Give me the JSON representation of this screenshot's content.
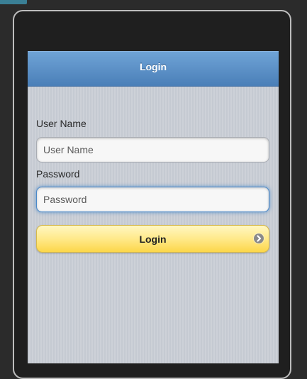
{
  "header": {
    "title": "Login"
  },
  "form": {
    "username": {
      "label": "User Name",
      "placeholder": "User Name",
      "value": ""
    },
    "password": {
      "label": "Password",
      "placeholder": "Password",
      "value": ""
    },
    "submit_label": "Login",
    "submit_icon": "chevron-right-circle-icon"
  },
  "colors": {
    "header_blue": "#5b93cb",
    "button_yellow": "#fce06a",
    "screen_bg": "#c9cdd4",
    "device_frame": "#1f1f1f"
  }
}
